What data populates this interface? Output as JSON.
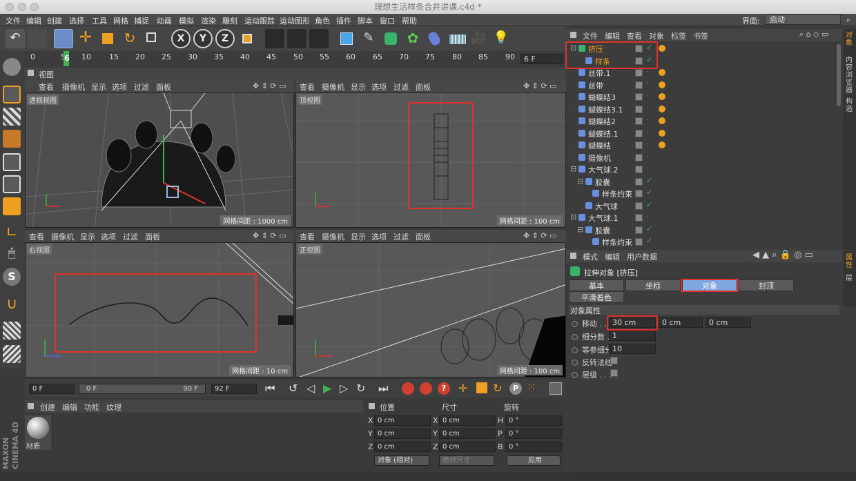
{
  "window": {
    "title": "理想生活样条合并讲课.c4d *"
  },
  "menubar": {
    "items": [
      "文件",
      "编辑",
      "创建",
      "选择",
      "工具",
      "网格",
      "捕捉",
      "动画",
      "模拟",
      "渲染",
      "雕刻",
      "运动跟踪",
      "运动图形",
      "角色",
      "插件",
      "脚本",
      "窗口",
      "帮助"
    ],
    "layout_label": "界面:",
    "layout_value": "启动"
  },
  "toolbar": {
    "axis_labels": [
      "X",
      "Y",
      "Z"
    ]
  },
  "ruler": {
    "ticks": [
      "0",
      "5",
      "10",
      "15",
      "20",
      "25",
      "30",
      "35",
      "40",
      "45",
      "50",
      "55",
      "60",
      "65",
      "70",
      "75",
      "80",
      "85",
      "90"
    ],
    "current_frame_marker": "6",
    "frame_field": "6 F"
  },
  "view_panel": {
    "title": "视图"
  },
  "viewport_menu": [
    "查看",
    "摄像机",
    "显示",
    "选项",
    "过滤",
    "面板"
  ],
  "viewports": [
    {
      "name": "透视视图",
      "grid": "网格间距 : 1000 cm"
    },
    {
      "name": "顶视图",
      "grid": "网格间距 : 100 cm"
    },
    {
      "name": "右视图",
      "grid": "网格间距 : 10 cm"
    },
    {
      "name": "正视图",
      "grid": "网格间距 : 100 cm"
    }
  ],
  "object_manager": {
    "menu": [
      "文件",
      "编辑",
      "查看",
      "对象",
      "标签",
      "书签"
    ],
    "objects": [
      {
        "name": "挤压",
        "indent": 0,
        "expander": "⊟",
        "highlight": true,
        "checked": true
      },
      {
        "name": "样条",
        "indent": 1,
        "expander": "",
        "highlight": true,
        "checked": true
      },
      {
        "name": "丝带.1",
        "indent": 0,
        "expander": "",
        "checked": false
      },
      {
        "name": "丝带",
        "indent": 0,
        "expander": "",
        "checked": false
      },
      {
        "name": "蝴蝶结3",
        "indent": 0,
        "expander": "",
        "checked": false
      },
      {
        "name": "蝴蝶结3.1",
        "indent": 0,
        "expander": "",
        "checked": false
      },
      {
        "name": "蝴蝶结2",
        "indent": 0,
        "expander": "",
        "checked": false
      },
      {
        "name": "蝴蝶结.1",
        "indent": 0,
        "expander": "",
        "checked": false
      },
      {
        "name": "蝴蝶结",
        "indent": 0,
        "expander": "",
        "checked": false
      },
      {
        "name": "摄像机",
        "indent": 0,
        "expander": "",
        "checked": false
      },
      {
        "name": "大气球.2",
        "indent": 0,
        "expander": "⊟",
        "checked": false
      },
      {
        "name": "胶囊",
        "indent": 1,
        "expander": "⊟",
        "checked": true
      },
      {
        "name": "样条约束",
        "indent": 2,
        "expander": "",
        "checked": true
      },
      {
        "name": "大气球",
        "indent": 1,
        "expander": "",
        "checked": true
      },
      {
        "name": "大气球.1",
        "indent": 0,
        "expander": "⊟",
        "checked": false
      },
      {
        "name": "胶囊",
        "indent": 1,
        "expander": "⊟",
        "checked": true
      },
      {
        "name": "样条约束",
        "indent": 2,
        "expander": "",
        "checked": true
      }
    ],
    "side_tabs": [
      "对象",
      "内容浏览器",
      "构造"
    ]
  },
  "attribute_manager": {
    "menu": [
      "模式",
      "编辑",
      "用户数据"
    ],
    "title": "拉伸对象 [挤压]",
    "tabs": [
      "基本",
      "坐标",
      "对象",
      "封顶"
    ],
    "active_tab": "对象",
    "phong_tab": "平滑着色(Phong)",
    "section": "对象属性",
    "move_label": "移动 . . .",
    "move_values": [
      "30 cm",
      "0 cm",
      "0 cm"
    ],
    "subdiv_label": "细分数 . .",
    "subdiv_value": "1",
    "iso_label": "等参细分",
    "iso_value": "10",
    "flip_label": "反转法线",
    "layer_label": "层级 . . .",
    "side_tabs": [
      "属性",
      "层"
    ]
  },
  "timeline": {
    "start": "0 F",
    "slider_left": "0 F",
    "slider_right": "90 F",
    "end": "92 F"
  },
  "material_manager": {
    "menu": [
      "创建",
      "编辑",
      "功能",
      "纹理"
    ],
    "material_name": "材质"
  },
  "coordinates": {
    "headers": [
      "位置",
      "尺寸",
      "旋转"
    ],
    "rows": [
      {
        "axis": "X",
        "pos": "0 cm",
        "size_axis": "X",
        "size": "0 cm",
        "rot_axis": "H",
        "rot": "0 °"
      },
      {
        "axis": "Y",
        "pos": "0 cm",
        "size_axis": "Y",
        "size": "0 cm",
        "rot_axis": "P",
        "rot": "0 °"
      },
      {
        "axis": "Z",
        "pos": "0 cm",
        "size_axis": "Z",
        "size": "0 cm",
        "rot_axis": "B",
        "rot": "0 °"
      }
    ],
    "mode_select": "对象 (相对)",
    "size_select": "绝对尺寸",
    "apply_button": "应用"
  },
  "brand": {
    "line1": "MAXON",
    "line2": "CINEMA 4D"
  },
  "colors": {
    "highlight_red": "#e0312b",
    "accent_orange": "#f0a020",
    "active_tab_blue": "#7ea6e0"
  }
}
